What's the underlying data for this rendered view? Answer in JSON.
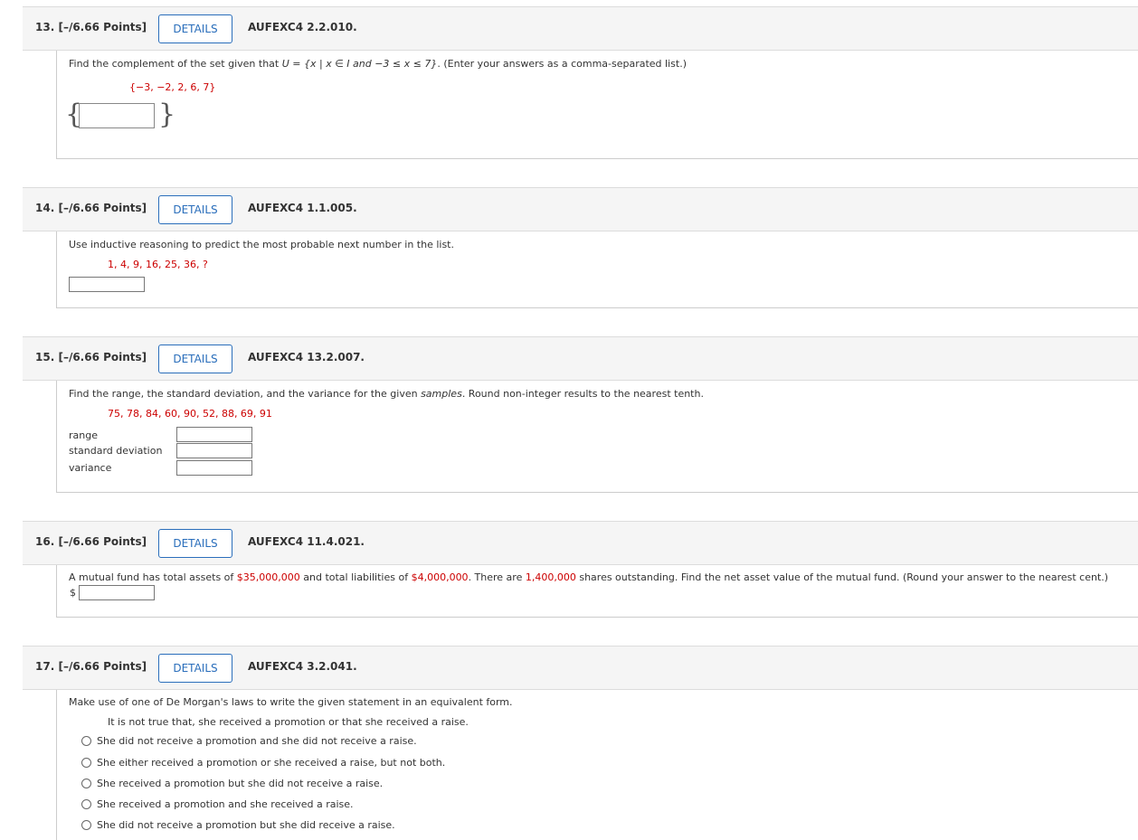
{
  "questions": [
    {
      "number": "13.",
      "points": "[–/6.66 Points]",
      "details_label": "DETAILS",
      "code": "AUFEXC4 2.2.010.",
      "prompt_start": "Find the complement of the set given that ",
      "prompt_math": "U = {x | x ∈ I and −3 ≤ x ≤ 7}",
      "prompt_end": ". (Enter your answers as a comma-separated list.)",
      "given_set": "{−3, −2, 2, 6, 7}",
      "brace_open": "{",
      "brace_close": "}"
    },
    {
      "number": "14.",
      "points": "[–/6.66 Points]",
      "details_label": "DETAILS",
      "code": "AUFEXC4 1.1.005.",
      "prompt": "Use inductive reasoning to predict the most probable next number in the list.",
      "sequence": "1, 4, 9, 16, 25, 36, ?"
    },
    {
      "number": "15.",
      "points": "[–/6.66 Points]",
      "details_label": "DETAILS",
      "code": "AUFEXC4 13.2.007.",
      "prompt_start": "Find the range, the standard deviation, and the variance for the given ",
      "prompt_emph": "samples",
      "prompt_end": ". Round non-integer results to the nearest tenth.",
      "data": "75, 78, 84, 60, 90, 52, 88, 69, 91",
      "labels": [
        "range",
        "standard deviation",
        "variance"
      ]
    },
    {
      "number": "16.",
      "points": "[–/6.66 Points]",
      "details_label": "DETAILS",
      "code": "AUFEXC4 11.4.021.",
      "p1": "A mutual fund has total assets of ",
      "assets": "$35,000,000",
      "p2": " and total liabilities of ",
      "liabilities": "$4,000,000",
      "p3": ". There are ",
      "shares": "1,400,000",
      "p4": " shares outstanding. Find the net asset value of the mutual fund. (Round your answer to the nearest cent.)",
      "currency": "$"
    },
    {
      "number": "17.",
      "points": "[–/6.66 Points]",
      "details_label": "DETAILS",
      "code": "AUFEXC4 3.2.041.",
      "prompt": "Make use of one of De Morgan's laws to write the given statement in an equivalent form.",
      "statement": "It is not true that, she received a promotion or that she received a raise.",
      "options": [
        "She did not receive a promotion and she did not receive a raise.",
        "She either received a promotion or she received a raise, but not both.",
        "She received a promotion but she did not receive a raise.",
        "She received a promotion and she received a raise.",
        "She did not receive a promotion but she did receive a raise."
      ]
    }
  ]
}
